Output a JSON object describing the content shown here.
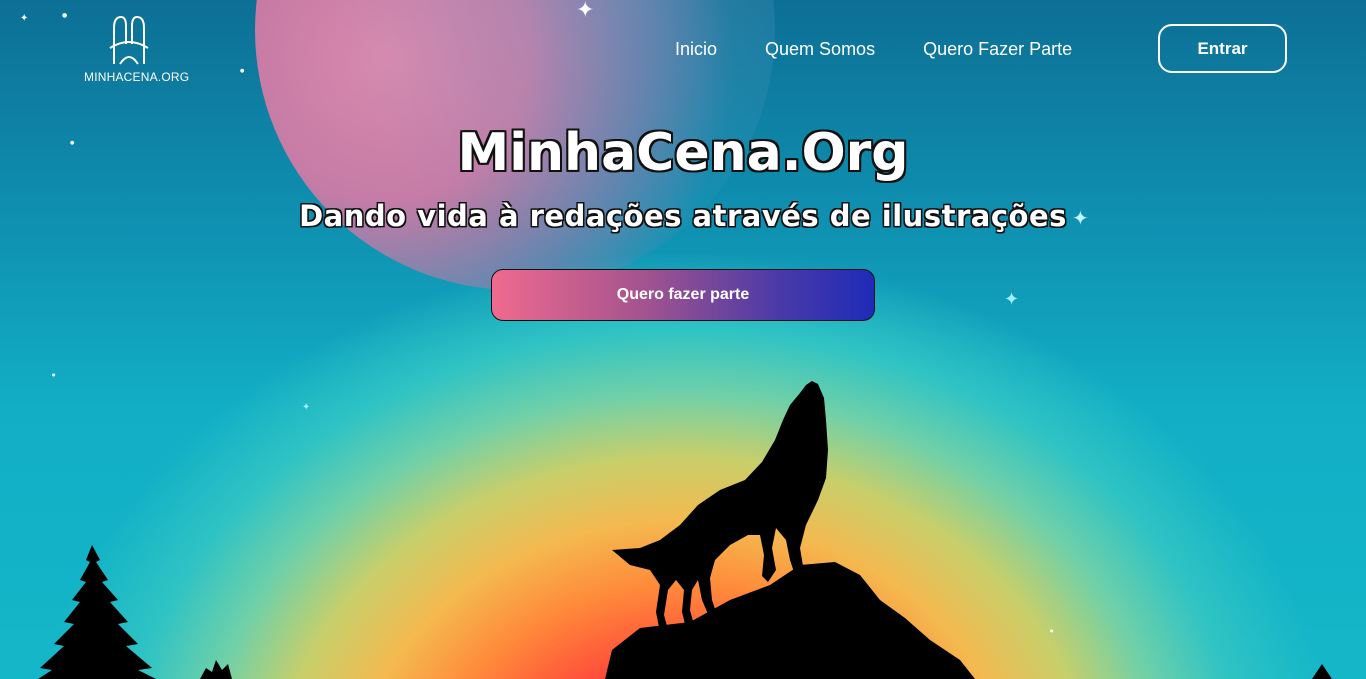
{
  "brand": {
    "name": "MINHACENA.ORG",
    "logo_icon": "mh-monogram-icon"
  },
  "nav": {
    "items": [
      {
        "label": "Inicio"
      },
      {
        "label": "Quem Somos"
      },
      {
        "label": "Quero Fazer Parte"
      }
    ],
    "login_label": "Entrar"
  },
  "hero": {
    "title": "MinhaCena.Org",
    "subtitle": "Dando vida à redações através de ilustrações",
    "cta_label": "Quero fazer parte"
  },
  "colors": {
    "sky_top": "#0d6f95",
    "sky_mid": "#14b7c8",
    "glow_red": "#ff2f3f",
    "glow_orange": "#ff8a3a",
    "glow_yellow": "#f4b94f",
    "moon_pink": "#f08bb0",
    "cta_start": "#ef6a8e",
    "cta_end": "#1e2bb8",
    "silhouette": "#000000"
  }
}
